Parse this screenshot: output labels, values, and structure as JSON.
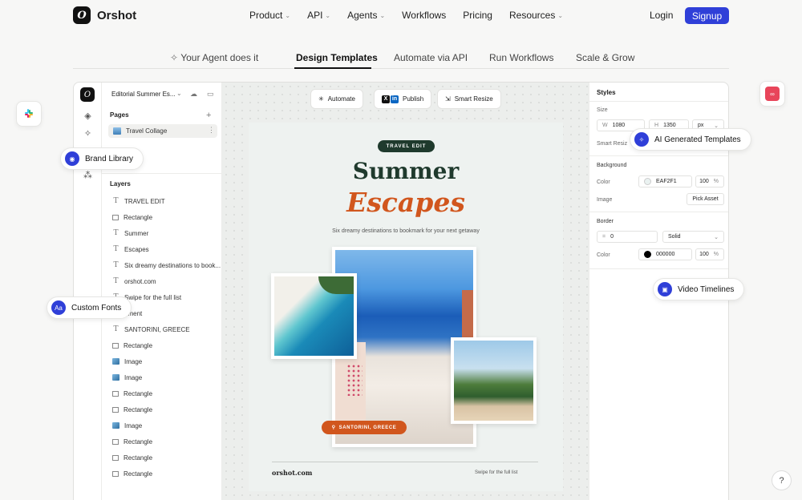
{
  "brand": {
    "name": "Orshot",
    "logo_glyph": "O",
    "accent": "#2f3fd8"
  },
  "nav": {
    "items": [
      {
        "label": "Product",
        "dropdown": true
      },
      {
        "label": "API",
        "dropdown": true
      },
      {
        "label": "Agents",
        "dropdown": true
      },
      {
        "label": "Workflows",
        "dropdown": false
      },
      {
        "label": "Pricing",
        "dropdown": false
      },
      {
        "label": "Resources",
        "dropdown": true
      }
    ],
    "login": "Login",
    "signup": "Signup"
  },
  "tabs": [
    {
      "label": "Your Agent does it",
      "icon": "sparkle-icon"
    },
    {
      "label": "Design Templates",
      "active": true
    },
    {
      "label": "Automate via API"
    },
    {
      "label": "Run Workflows"
    },
    {
      "label": "Scale & Grow"
    }
  ],
  "editor": {
    "doc_title": "Editorial Summer Es...",
    "pages_title": "Pages",
    "page_item": "Travel Collage",
    "layers_title": "Layers",
    "layers": [
      {
        "type": "text",
        "label": "TRAVEL EDIT"
      },
      {
        "type": "rect",
        "label": "Rectangle"
      },
      {
        "type": "text",
        "label": "Summer"
      },
      {
        "type": "text",
        "label": "Escapes"
      },
      {
        "type": "text",
        "label": "Six dreamy destinations to book..."
      },
      {
        "type": "text",
        "label": "orshot.com"
      },
      {
        "type": "text",
        "label": "Swipe for the full list"
      },
      {
        "type": "element",
        "label": "ement"
      },
      {
        "type": "text",
        "label": "SANTORINI, GREECE"
      },
      {
        "type": "rect",
        "label": "Rectangle"
      },
      {
        "type": "img",
        "label": "Image"
      },
      {
        "type": "img",
        "label": "Image"
      },
      {
        "type": "rect",
        "label": "Rectangle"
      },
      {
        "type": "rect",
        "label": "Rectangle"
      },
      {
        "type": "img",
        "label": "Image"
      },
      {
        "type": "rect",
        "label": "Rectangle"
      },
      {
        "type": "rect",
        "label": "Rectangle"
      },
      {
        "type": "rect",
        "label": "Rectangle"
      }
    ]
  },
  "toolbar": {
    "automate": "Automate",
    "publish": "Publish",
    "smart_resize": "Smart Resize"
  },
  "design": {
    "pill": "TRAVEL EDIT",
    "title_1": "Summer",
    "title_2": "Escapes",
    "subtitle": "Six dreamy destinations to bookmark for your next getaway",
    "location": "SANTORINI, GREECE",
    "footer_left": "orshot.com",
    "footer_right": "Swipe for the full list"
  },
  "styles": {
    "title": "Styles",
    "size_label": "Size",
    "w_label": "W",
    "w_value": "1080",
    "h_label": "H",
    "h_value": "1350",
    "unit": "px",
    "smart_resize_label": "Smart Resiz",
    "background_label": "Background",
    "color_label": "Color",
    "bg_color": "EAF2F1",
    "bg_opacity": "100",
    "percent": "%",
    "image_label": "Image",
    "pick_asset": "Pick Asset",
    "border_label": "Border",
    "border_width": "0",
    "border_style": "Solid",
    "border_color_label": "Color",
    "border_color": "000000",
    "border_opacity": "100"
  },
  "floats": {
    "brand_library": "Brand Library",
    "custom_fonts": "Custom Fonts",
    "ai_templates": "AI Generated Templates",
    "video_timelines": "Video Timelines"
  },
  "help": "?"
}
